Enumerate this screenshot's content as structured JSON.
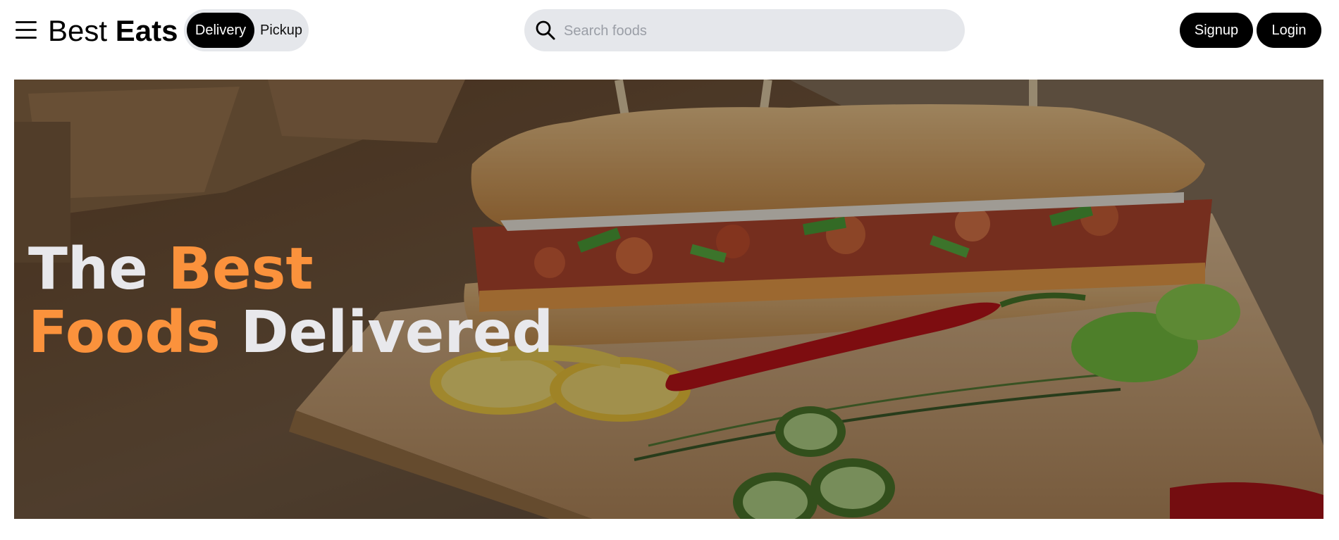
{
  "header": {
    "brand_light": "Best",
    "brand_bold": "Eats",
    "toggle": {
      "active_label": "Delivery",
      "inactive_label": "Pickup"
    },
    "search": {
      "placeholder": "Search foods",
      "value": ""
    },
    "signup_label": "Signup",
    "login_label": "Login"
  },
  "hero": {
    "line1_white": "The",
    "line1_orange": "Best",
    "line2_orange": "Foods",
    "line2_white": "Delivered",
    "image_subject": "sandwich-on-cutting-board"
  },
  "colors": {
    "accent": "#fb923c",
    "button_bg": "#000000",
    "pill_bg": "#e5e7eb",
    "headline_white": "#e8e8ec"
  },
  "icons": [
    "menu-icon",
    "search-icon"
  ]
}
